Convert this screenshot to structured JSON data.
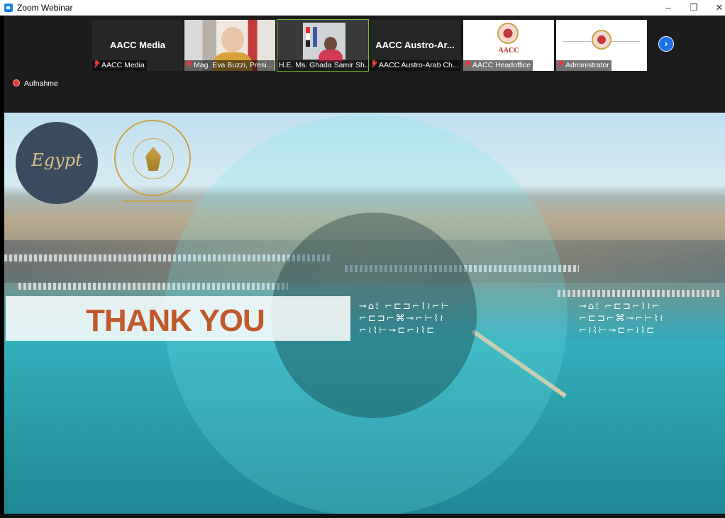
{
  "window": {
    "title": "Zoom Webinar",
    "controls": {
      "minimize": "–",
      "maximize": "❐",
      "close": "✕"
    }
  },
  "participants": [
    {
      "display_name": "AACC Media",
      "label": "AACC Media",
      "muted": true,
      "has_video": false
    },
    {
      "display_name": "",
      "label": "Mag. Eva Buzzi, Presi...",
      "muted": true,
      "has_video": true
    },
    {
      "display_name": "",
      "label": "H.E. Ms. Ghada Samir Sh...",
      "muted": false,
      "has_video": true
    },
    {
      "display_name": "AACC Austro-Ar...",
      "label": "AACC Austro-Arab Ch...",
      "muted": true,
      "has_video": false
    },
    {
      "display_name": "",
      "label": "AACC Headoffice",
      "muted": true,
      "has_video": false,
      "logo_text": "AACC"
    },
    {
      "display_name": "",
      "label": "Administrator",
      "muted": true,
      "has_video": false
    }
  ],
  "next_page_button": "›",
  "recording": {
    "label": "Aufnahme"
  },
  "slide": {
    "logo_egypt_text": "Egypt",
    "banner_text": "THANK YOU",
    "hieroglyphs_left": "⊸⌂⟟ ⌐⊏⊐⌐⌇≀⌐⊢\n⌐⊏⊐⌐⌘⊸⌐⊢⌇≀\n⌐≀⌇⊢⊸⊏⌐≀⌇⊏",
    "hieroglyphs_right": "⊸⌂⟟ ⌐⊏⊐⌐⌇≀⌐\n⌐⊏⊐⌐⌘⊸⌐⊢⌇≀\n⌐≀⌇⊢⊸⊏⌐≀⌇⊏"
  },
  "colors": {
    "titlebar_bg": "#ffffff",
    "topbar_bg": "#1c1c1c",
    "accent_blue": "#1a73e8",
    "mute_red": "#e53935",
    "banner_text": "#c0582a",
    "gold": "#c9a347"
  }
}
